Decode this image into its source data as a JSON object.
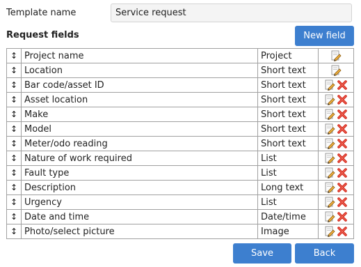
{
  "template": {
    "label": "Template name",
    "value": "Service request"
  },
  "section": {
    "title": "Request fields",
    "new_button": "New field"
  },
  "fields": [
    {
      "name": "Project name",
      "type": "Project",
      "editable": true,
      "deletable": false
    },
    {
      "name": "Location",
      "type": "Short text",
      "editable": true,
      "deletable": false
    },
    {
      "name": "Bar code/asset ID",
      "type": "Short text",
      "editable": true,
      "deletable": true
    },
    {
      "name": "Asset location",
      "type": "Short text",
      "editable": true,
      "deletable": true
    },
    {
      "name": "Make",
      "type": "Short text",
      "editable": true,
      "deletable": true
    },
    {
      "name": "Model",
      "type": "Short text",
      "editable": true,
      "deletable": true
    },
    {
      "name": "Meter/odo reading",
      "type": "Short text",
      "editable": true,
      "deletable": true
    },
    {
      "name": "Nature of work required",
      "type": "List",
      "editable": true,
      "deletable": true
    },
    {
      "name": "Fault type",
      "type": "List",
      "editable": true,
      "deletable": true
    },
    {
      "name": "Description",
      "type": "Long text",
      "editable": true,
      "deletable": true
    },
    {
      "name": "Urgency",
      "type": "List",
      "editable": true,
      "deletable": true
    },
    {
      "name": "Date and time",
      "type": "Date/time",
      "editable": true,
      "deletable": true
    },
    {
      "name": "Photo/select picture",
      "type": "Image",
      "editable": true,
      "deletable": true
    }
  ],
  "footer": {
    "save": "Save",
    "back": "Back"
  },
  "icons": {
    "handle": "drag-handle-icon",
    "edit": "edit-pencil-icon",
    "delete": "delete-x-icon"
  },
  "colors": {
    "button": "#3d7fcf",
    "delete": "#d42a1e",
    "pencil": "#e0a23a"
  }
}
